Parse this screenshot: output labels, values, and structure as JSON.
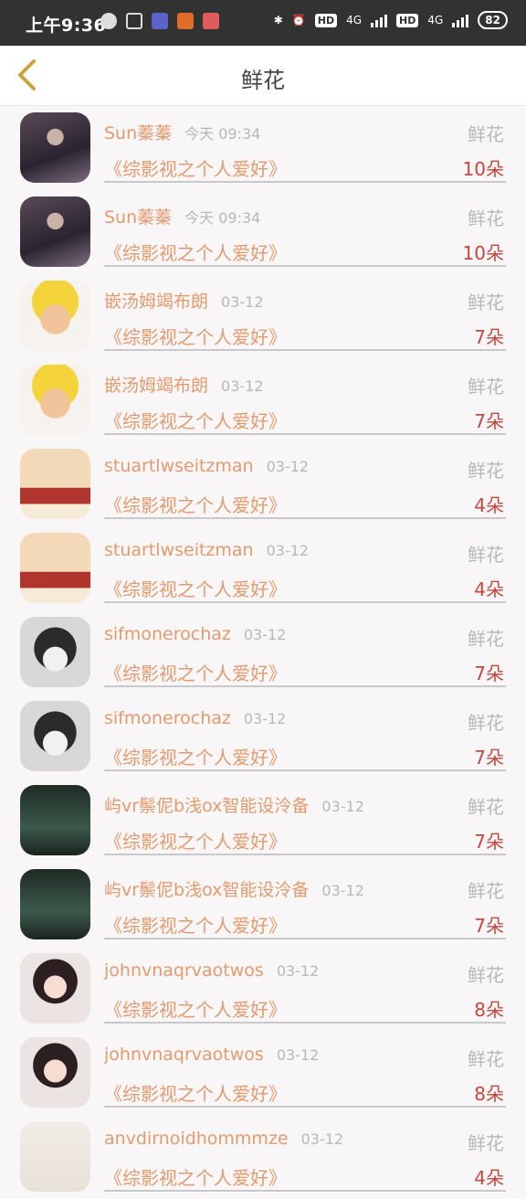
{
  "status_bar": {
    "time": "上午9:36",
    "hd1": "HD",
    "net1": "4G",
    "hd2": "HD",
    "net2": "4G",
    "battery": "82"
  },
  "header": {
    "title": "鲜花"
  },
  "items": [
    {
      "name": "Sun蓁蓁",
      "date": "今天 09:34",
      "type": "鲜花",
      "book": "《综影视之个人爱好》",
      "count": "10朵",
      "avatar": "photo-dark"
    },
    {
      "name": "Sun蓁蓁",
      "date": "今天 09:34",
      "type": "鲜花",
      "book": "《综影视之个人爱好》",
      "count": "10朵",
      "avatar": "photo-dark"
    },
    {
      "name": "嵌汤姆竭布朗",
      "date": "03-12",
      "type": "鲜花",
      "book": "《综影视之个人爱好》",
      "count": "7朵",
      "avatar": "cartoon"
    },
    {
      "name": "嵌汤姆竭布朗",
      "date": "03-12",
      "type": "鲜花",
      "book": "《综影视之个人爱好》",
      "count": "7朵",
      "avatar": "cartoon"
    },
    {
      "name": "stuartlwseitzman",
      "date": "03-12",
      "type": "鲜花",
      "book": "《综影视之个人爱好》",
      "count": "4朵",
      "avatar": "scarf"
    },
    {
      "name": "stuartlwseitzman",
      "date": "03-12",
      "type": "鲜花",
      "book": "《综影视之个人爱好》",
      "count": "4朵",
      "avatar": "scarf"
    },
    {
      "name": "sifmonerochaz",
      "date": "03-12",
      "type": "鲜花",
      "book": "《综影视之个人爱好》",
      "count": "7朵",
      "avatar": "husky"
    },
    {
      "name": "sifmonerochaz",
      "date": "03-12",
      "type": "鲜花",
      "book": "《综影视之个人爱好》",
      "count": "7朵",
      "avatar": "husky"
    },
    {
      "name": "屿vr鬃伲b浅ox智能设泠备",
      "date": "03-12",
      "type": "鲜花",
      "book": "《综影视之个人爱好》",
      "count": "7朵",
      "avatar": "forest"
    },
    {
      "name": "屿vr鬃伲b浅ox智能设泠备",
      "date": "03-12",
      "type": "鲜花",
      "book": "《综影视之个人爱好》",
      "count": "7朵",
      "avatar": "forest"
    },
    {
      "name": "johnvnaqrvaotwos",
      "date": "03-12",
      "type": "鲜花",
      "book": "《综影视之个人爱好》",
      "count": "8朵",
      "avatar": "girl"
    },
    {
      "name": "johnvnaqrvaotwos",
      "date": "03-12",
      "type": "鲜花",
      "book": "《综影视之个人爱好》",
      "count": "8朵",
      "avatar": "girl"
    },
    {
      "name": "anvdirnoidhommmze",
      "date": "03-12",
      "type": "鲜花",
      "book": "《综影视之个人爱好》",
      "count": "4朵",
      "avatar": "mustache"
    }
  ]
}
